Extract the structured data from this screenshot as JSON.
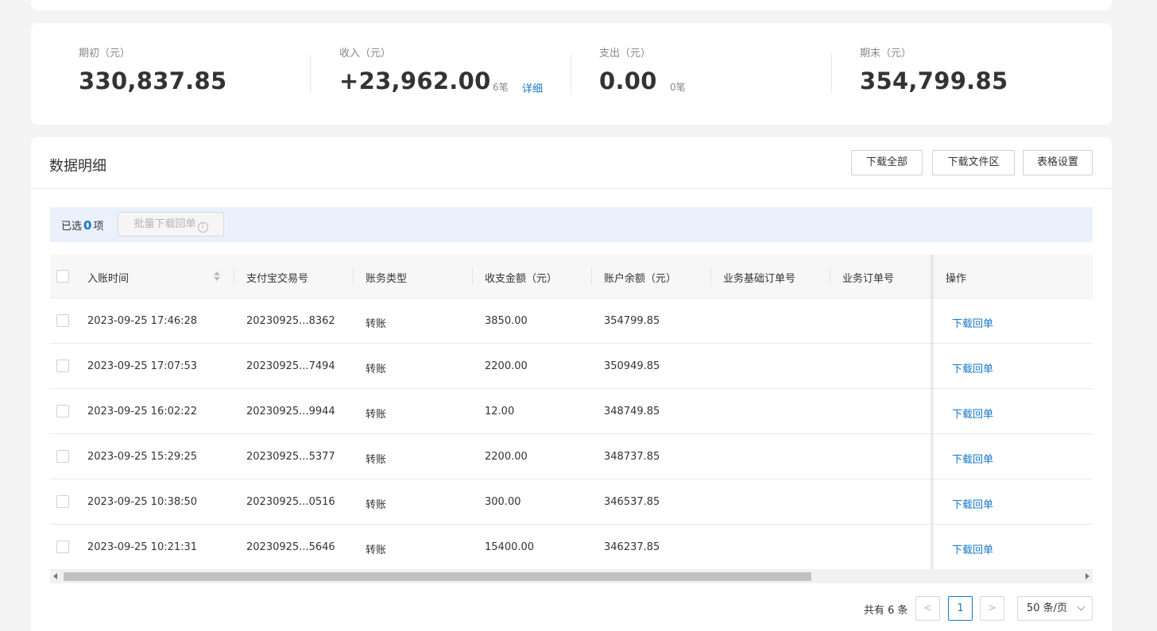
{
  "summary": {
    "opening": {
      "label": "期初（元）",
      "value": "330,837.85"
    },
    "income": {
      "label": "收入（元）",
      "value": "+23,962.00",
      "count": "6笔",
      "link": "详细"
    },
    "expense": {
      "label": "支出（元）",
      "value": "0.00",
      "count": "0笔"
    },
    "closing": {
      "label": "期末（元）",
      "value": "354,799.85"
    }
  },
  "detail": {
    "title": "数据明细",
    "buttons": {
      "download_all": "下载全部",
      "download_files": "下载文件区",
      "table_settings": "表格设置"
    }
  },
  "selection": {
    "prefix": "已选",
    "count": "0",
    "suffix": "项",
    "batch_button": "批量下载回单",
    "info_icon": "i"
  },
  "table": {
    "headers": [
      "入账时间",
      "支付宝交易号",
      "账务类型",
      "收支金额（元）",
      "账户余额（元）",
      "业务基础订单号",
      "业务订单号",
      "操作"
    ],
    "rows": [
      {
        "time": "2023-09-25 17:46:28",
        "trade_no": "20230925...8362",
        "type": "转账",
        "amount": "3850.00",
        "balance": "354799.85",
        "action": "下载回单"
      },
      {
        "time": "2023-09-25 17:07:53",
        "trade_no": "20230925...7494",
        "type": "转账",
        "amount": "2200.00",
        "balance": "350949.85",
        "action": "下载回单"
      },
      {
        "time": "2023-09-25 16:02:22",
        "trade_no": "20230925...9944",
        "type": "转账",
        "amount": "12.00",
        "balance": "348749.85",
        "action": "下载回单"
      },
      {
        "time": "2023-09-25 15:29:25",
        "trade_no": "20230925...5377",
        "type": "转账",
        "amount": "2200.00",
        "balance": "348737.85",
        "action": "下载回单"
      },
      {
        "time": "2023-09-25 10:38:50",
        "trade_no": "20230925...0516",
        "type": "转账",
        "amount": "300.00",
        "balance": "346537.85",
        "action": "下载回单"
      },
      {
        "time": "2023-09-25 10:21:31",
        "trade_no": "20230925...5646",
        "type": "转账",
        "amount": "15400.00",
        "balance": "346237.85",
        "action": "下载回单"
      }
    ]
  },
  "pagination": {
    "total": "共有 6 条",
    "prev": "<",
    "page": "1",
    "next": ">",
    "page_size": "50 条/页"
  },
  "colors": {
    "accent": "#1677c8",
    "selection_bg": "#ebf1fc",
    "page_bg": "#f4f4f4"
  }
}
